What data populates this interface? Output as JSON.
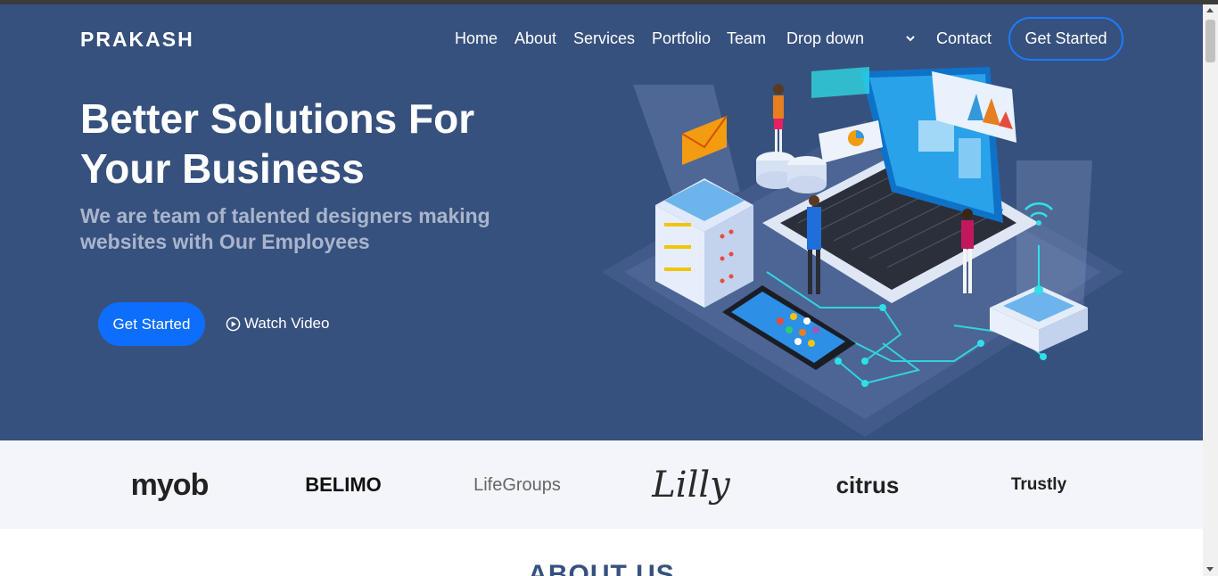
{
  "brand": "PRAKASH",
  "nav": {
    "home": "Home",
    "about": "About",
    "services": "Services",
    "portfolio": "Portfolio",
    "team": "Team",
    "dropdown": "Drop down",
    "contact": "Contact",
    "cta": "Get Started"
  },
  "hero": {
    "headline_line1": "Better Solutions For",
    "headline_line2": "Your Business",
    "subtext_line1": "We are team of talented designers making",
    "subtext_line2": "websites with Our Employees",
    "start_button": "Get Started",
    "watch_video": "Watch Video"
  },
  "clients": {
    "myob": "myob",
    "belimo": "BELIMO",
    "lifegroups": "LifeGroups",
    "lilly": "Lilly",
    "citrus": "citrus",
    "trustly": "Trustly"
  },
  "about": {
    "title": "ABOUT US"
  },
  "colors": {
    "hero_bg": "#37517e",
    "accent": "#0d6efd",
    "clients_bg": "#f3f5fa"
  }
}
